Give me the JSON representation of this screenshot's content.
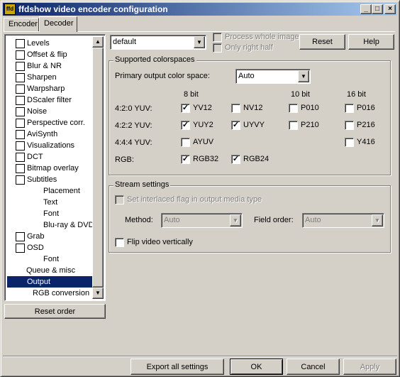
{
  "window": {
    "title": "ffdshow video encoder configuration",
    "icon_text": "ffd"
  },
  "title_buttons": {
    "minimize": "_",
    "maximize": "□",
    "close": "×"
  },
  "tabs": [
    {
      "label": "Encoder"
    },
    {
      "label": "Decoder"
    }
  ],
  "tree": {
    "items": [
      {
        "label": "Levels",
        "checkbox": true
      },
      {
        "label": "Offset & flip",
        "checkbox": true
      },
      {
        "label": "Blur & NR",
        "checkbox": true
      },
      {
        "label": "Sharpen",
        "checkbox": true
      },
      {
        "label": "Warpsharp",
        "checkbox": true
      },
      {
        "label": "DScaler filter",
        "checkbox": true
      },
      {
        "label": "Noise",
        "checkbox": true
      },
      {
        "label": "Perspective corr.",
        "checkbox": true
      },
      {
        "label": "AviSynth",
        "checkbox": true
      },
      {
        "label": "Visualizations",
        "checkbox": true
      },
      {
        "label": "DCT",
        "checkbox": true
      },
      {
        "label": "Bitmap overlay",
        "checkbox": true
      },
      {
        "label": "Subtitles",
        "checkbox": true
      },
      {
        "label": "Placement",
        "checkbox": false
      },
      {
        "label": "Text",
        "checkbox": false
      },
      {
        "label": "Font",
        "checkbox": false
      },
      {
        "label": "Blu-ray & DVD",
        "checkbox": false
      },
      {
        "label": "Grab",
        "checkbox": true
      },
      {
        "label": "OSD",
        "checkbox": true
      },
      {
        "label": "Font",
        "checkbox": false
      },
      {
        "label": "Queue & misc",
        "checkbox": false
      },
      {
        "label": "Output",
        "checkbox": false,
        "selected": true
      },
      {
        "label": "RGB conversion",
        "checkbox": false
      }
    ],
    "scroll_up": "▲",
    "scroll_down": "▼"
  },
  "reset_order_label": "Reset order",
  "preset": {
    "value": "default",
    "arrow": "▼"
  },
  "process_whole_image_label": "Process whole image",
  "only_right_half_label": "Only right half",
  "reset_label": "Reset",
  "help_label": "Help",
  "colorspaces": {
    "legend": "Supported colorspaces",
    "primary_label": "Primary output color space:",
    "primary_value": "Auto",
    "col_8bit": "8 bit",
    "col_10bit": "10 bit",
    "col_16bit": "16 bit",
    "rows": [
      {
        "label": "4:2:0 YUV:"
      },
      {
        "label": "4:2:2 YUV:"
      },
      {
        "label": "4:4:4 YUV:"
      },
      {
        "label": "RGB:"
      }
    ],
    "options": [
      {
        "label": "YV12",
        "checked": true
      },
      {
        "label": "NV12",
        "checked": false
      },
      {
        "label": "P010",
        "checked": false
      },
      {
        "label": "P016",
        "checked": false
      },
      {
        "label": "YUY2",
        "checked": true
      },
      {
        "label": "UYVY",
        "checked": true
      },
      {
        "label": "P210",
        "checked": false
      },
      {
        "label": "P216",
        "checked": false
      },
      {
        "label": "AYUV",
        "checked": false
      },
      {
        "label": "Y416",
        "checked": false
      },
      {
        "label": "RGB32",
        "checked": true
      },
      {
        "label": "RGB24",
        "checked": true
      }
    ],
    "check_mark": "✓"
  },
  "stream": {
    "legend": "Stream settings",
    "interlaced_label": "Set interlaced flag in output media type",
    "method_label": "Method:",
    "method_value": "Auto",
    "field_order_label": "Field order:",
    "field_order_value": "Auto",
    "flip_label": "Flip video vertically"
  },
  "footer": {
    "export_label": "Export all settings",
    "ok_label": "OK",
    "cancel_label": "Cancel",
    "apply_label": "Apply"
  }
}
